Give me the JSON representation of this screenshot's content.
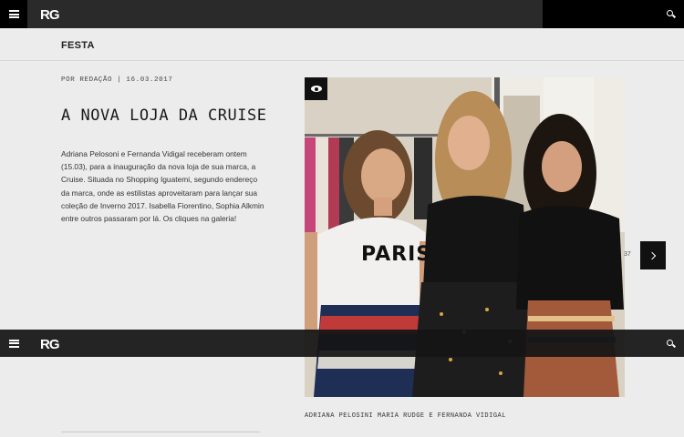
{
  "header": {
    "logo": "RG",
    "menu_icon": "hamburger-menu-icon",
    "search_icon": "search-icon"
  },
  "category": "FESTA",
  "article": {
    "byline": "POR REDAÇÃO | 16.03.2017",
    "title": "A NOVA LOJA DA CRUISE",
    "body": "Adriana Pelosoni e Fernanda Vidigal receberam ontem (15.03), para a inauguração da nova loja de sua marca, a Cruise. Situada no Shopping Iguatemi, segundo endereço da marca, onde as estilistas aproveitaram para lançar sua coleção de Inverno 2017. Isabella Fiorentino, Sophia Alkmin entre outros passaram por lá. Os cliques na galeria!"
  },
  "gallery": {
    "counter": "37",
    "caption": "ADRIANA PELOSINI MARIA RUDGE E FERNANDA VIDIGAL",
    "shirt_print": "PARIS",
    "view_icon": "eye-icon",
    "next_icon": "chevron-right-icon"
  },
  "sticky_header": {
    "logo": "RG"
  },
  "colors": {
    "bar": "#2a2a2a",
    "bar_dark": "#000000",
    "page_bg": "#ececec",
    "text": "#1a1a1a"
  }
}
